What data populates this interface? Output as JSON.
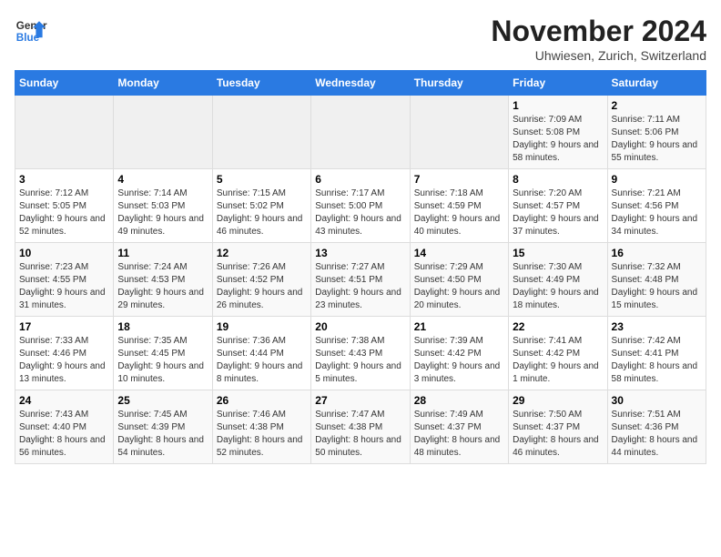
{
  "header": {
    "logo_line1": "General",
    "logo_line2": "Blue",
    "main_title": "November 2024",
    "subtitle": "Uhwiesen, Zurich, Switzerland"
  },
  "columns": [
    "Sunday",
    "Monday",
    "Tuesday",
    "Wednesday",
    "Thursday",
    "Friday",
    "Saturday"
  ],
  "weeks": [
    [
      {
        "day": "",
        "info": ""
      },
      {
        "day": "",
        "info": ""
      },
      {
        "day": "",
        "info": ""
      },
      {
        "day": "",
        "info": ""
      },
      {
        "day": "",
        "info": ""
      },
      {
        "day": "1",
        "info": "Sunrise: 7:09 AM\nSunset: 5:08 PM\nDaylight: 9 hours and 58 minutes."
      },
      {
        "day": "2",
        "info": "Sunrise: 7:11 AM\nSunset: 5:06 PM\nDaylight: 9 hours and 55 minutes."
      }
    ],
    [
      {
        "day": "3",
        "info": "Sunrise: 7:12 AM\nSunset: 5:05 PM\nDaylight: 9 hours and 52 minutes."
      },
      {
        "day": "4",
        "info": "Sunrise: 7:14 AM\nSunset: 5:03 PM\nDaylight: 9 hours and 49 minutes."
      },
      {
        "day": "5",
        "info": "Sunrise: 7:15 AM\nSunset: 5:02 PM\nDaylight: 9 hours and 46 minutes."
      },
      {
        "day": "6",
        "info": "Sunrise: 7:17 AM\nSunset: 5:00 PM\nDaylight: 9 hours and 43 minutes."
      },
      {
        "day": "7",
        "info": "Sunrise: 7:18 AM\nSunset: 4:59 PM\nDaylight: 9 hours and 40 minutes."
      },
      {
        "day": "8",
        "info": "Sunrise: 7:20 AM\nSunset: 4:57 PM\nDaylight: 9 hours and 37 minutes."
      },
      {
        "day": "9",
        "info": "Sunrise: 7:21 AM\nSunset: 4:56 PM\nDaylight: 9 hours and 34 minutes."
      }
    ],
    [
      {
        "day": "10",
        "info": "Sunrise: 7:23 AM\nSunset: 4:55 PM\nDaylight: 9 hours and 31 minutes."
      },
      {
        "day": "11",
        "info": "Sunrise: 7:24 AM\nSunset: 4:53 PM\nDaylight: 9 hours and 29 minutes."
      },
      {
        "day": "12",
        "info": "Sunrise: 7:26 AM\nSunset: 4:52 PM\nDaylight: 9 hours and 26 minutes."
      },
      {
        "day": "13",
        "info": "Sunrise: 7:27 AM\nSunset: 4:51 PM\nDaylight: 9 hours and 23 minutes."
      },
      {
        "day": "14",
        "info": "Sunrise: 7:29 AM\nSunset: 4:50 PM\nDaylight: 9 hours and 20 minutes."
      },
      {
        "day": "15",
        "info": "Sunrise: 7:30 AM\nSunset: 4:49 PM\nDaylight: 9 hours and 18 minutes."
      },
      {
        "day": "16",
        "info": "Sunrise: 7:32 AM\nSunset: 4:48 PM\nDaylight: 9 hours and 15 minutes."
      }
    ],
    [
      {
        "day": "17",
        "info": "Sunrise: 7:33 AM\nSunset: 4:46 PM\nDaylight: 9 hours and 13 minutes."
      },
      {
        "day": "18",
        "info": "Sunrise: 7:35 AM\nSunset: 4:45 PM\nDaylight: 9 hours and 10 minutes."
      },
      {
        "day": "19",
        "info": "Sunrise: 7:36 AM\nSunset: 4:44 PM\nDaylight: 9 hours and 8 minutes."
      },
      {
        "day": "20",
        "info": "Sunrise: 7:38 AM\nSunset: 4:43 PM\nDaylight: 9 hours and 5 minutes."
      },
      {
        "day": "21",
        "info": "Sunrise: 7:39 AM\nSunset: 4:42 PM\nDaylight: 9 hours and 3 minutes."
      },
      {
        "day": "22",
        "info": "Sunrise: 7:41 AM\nSunset: 4:42 PM\nDaylight: 9 hours and 1 minute."
      },
      {
        "day": "23",
        "info": "Sunrise: 7:42 AM\nSunset: 4:41 PM\nDaylight: 8 hours and 58 minutes."
      }
    ],
    [
      {
        "day": "24",
        "info": "Sunrise: 7:43 AM\nSunset: 4:40 PM\nDaylight: 8 hours and 56 minutes."
      },
      {
        "day": "25",
        "info": "Sunrise: 7:45 AM\nSunset: 4:39 PM\nDaylight: 8 hours and 54 minutes."
      },
      {
        "day": "26",
        "info": "Sunrise: 7:46 AM\nSunset: 4:38 PM\nDaylight: 8 hours and 52 minutes."
      },
      {
        "day": "27",
        "info": "Sunrise: 7:47 AM\nSunset: 4:38 PM\nDaylight: 8 hours and 50 minutes."
      },
      {
        "day": "28",
        "info": "Sunrise: 7:49 AM\nSunset: 4:37 PM\nDaylight: 8 hours and 48 minutes."
      },
      {
        "day": "29",
        "info": "Sunrise: 7:50 AM\nSunset: 4:37 PM\nDaylight: 8 hours and 46 minutes."
      },
      {
        "day": "30",
        "info": "Sunrise: 7:51 AM\nSunset: 4:36 PM\nDaylight: 8 hours and 44 minutes."
      }
    ]
  ]
}
